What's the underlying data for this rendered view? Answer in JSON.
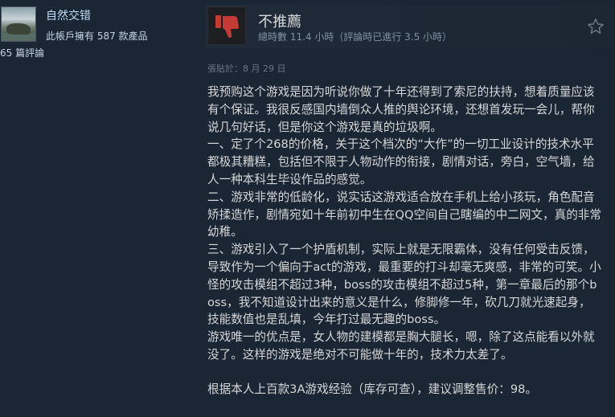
{
  "author": {
    "name": "自然交错",
    "products": "此帳戶擁有 587 款產品",
    "reviews": "65 篇評論"
  },
  "review": {
    "verdict": "不推薦",
    "hours_label": "總時數 11.4 小時（評論時已進行 3.5 小時）",
    "posted": "張貼於：8 月 29 日",
    "paragraphs": [
      "我预购这个游戏是因为听说你做了十年还得到了索尼的扶持，想着质量应该有个保证。我很反感国内墙倒众人推的舆论环境，还想首发玩一会儿，帮你说几句好话，但是你这个游戏是真的垃圾啊。",
      "一、定了个268的价格，关于这个档次的“大作”的一切工业设计的技术水平都极其糟糕，包括但不限于人物动作的衔接，剧情对话，旁白，空气墙，给人一种本科生毕设作品的感觉。",
      "二、游戏非常的低龄化，说实话这游戏适合放在手机上给小孩玩，角色配音矫揉造作，剧情宛如十年前初中生在QQ空间自己瞎编的中二网文，真的非常幼稚。",
      "三、游戏引入了一个护盾机制，实际上就是无限霸体，没有任何受击反馈，导致作为一个偏向于act的游戏，最重要的打斗却毫无爽感，非常的可笑。小怪的攻击模组不超过3种，boss的攻击模组不超过5种，第一章最后的那个boss，我不知道设计出来的意义是什么，修脚修一年，砍几刀就光速起身，技能数值也是乱填，今年打过最无趣的boss。",
      "游戏唯一的优点是，女人物的建模都是胸大腿长，嗯，除了这点能看以外就没了。这样的游戏是绝对不可能做十年的，技术力太差了。",
      "",
      "根据本人上百款3A游戏经验（库存可查），建议调整售价：98。"
    ]
  },
  "colors": {
    "background": "#1a2634",
    "thumb_down_red": "#c43a35",
    "text": "#d6d7d8",
    "link_blue": "#c1dbf4"
  },
  "icons": {
    "verdict": "thumbs-down-icon",
    "award": "award-icon"
  }
}
